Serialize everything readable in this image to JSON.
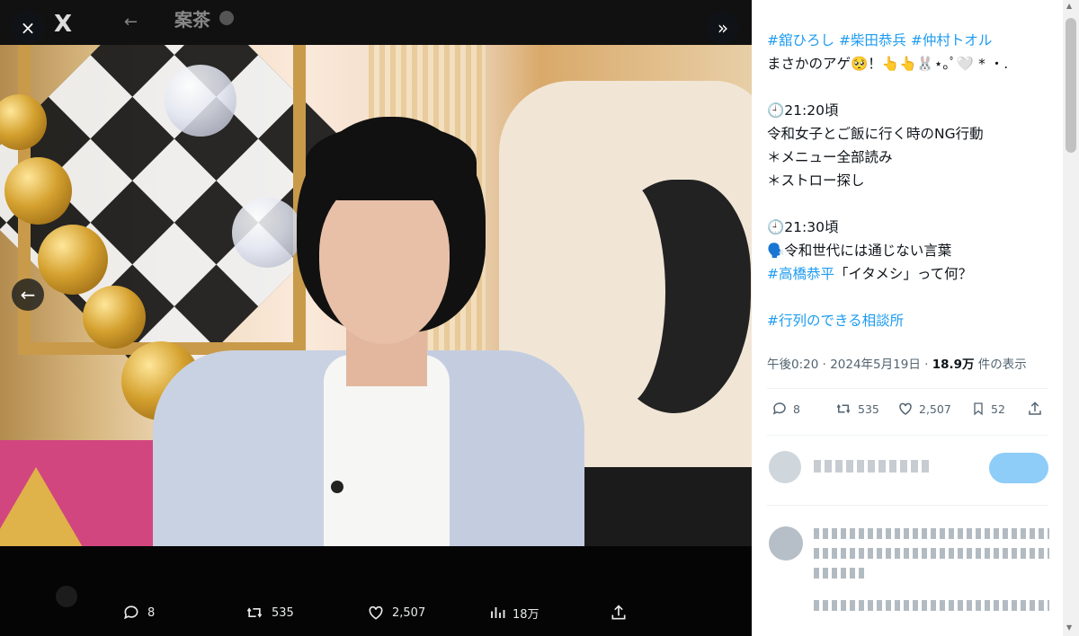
{
  "viewer": {
    "close_icon": "×",
    "expand_icon": "»",
    "prev_icon": "←",
    "background_header": {
      "logo": "X",
      "back_icon": "←",
      "account_name": "案茶"
    }
  },
  "image_actions": {
    "reply_count": "8",
    "retweet_count": "535",
    "like_count": "2,507",
    "views_count": "18万"
  },
  "tweet": {
    "lines": [
      [
        {
          "t": "#舘ひろし",
          "tag": true
        },
        {
          "t": " "
        },
        {
          "t": "#柴田恭兵",
          "tag": true
        },
        {
          "t": " "
        },
        {
          "t": "#仲村トオル",
          "tag": true
        }
      ],
      [
        {
          "t": "まさかのアゲ🥺！👆👆🐰⋆｡ﾟ🤍 * ・."
        }
      ],
      [],
      [
        {
          "t": "🕘21:20頃"
        }
      ],
      [
        {
          "t": "令和女子とご飯に行く時のNG行動"
        }
      ],
      [
        {
          "t": "＊メニュー全部読み"
        }
      ],
      [
        {
          "t": "＊ストロー探し"
        }
      ],
      [],
      [
        {
          "t": "🕘21:30頃"
        }
      ],
      [
        {
          "t": "🗣️令和世代には通じない言葉"
        }
      ],
      [
        {
          "t": "#高橋恭平",
          "tag": true
        },
        {
          "t": "「イタメシ」って何？"
        }
      ],
      [],
      [
        {
          "t": "#行列のできる相談所",
          "tag": true
        }
      ]
    ],
    "meta": {
      "time": "午後0:20",
      "sep": " · ",
      "date": "2024年5月19日",
      "views_number": "18.9万",
      "views_suffix": " 件の表示"
    },
    "stats": {
      "reply": "8",
      "retweet": "535",
      "like": "2,507",
      "bookmark": "52"
    }
  },
  "icons": {
    "close": "close-icon",
    "expand": "chevron-double-right-icon",
    "prev": "arrow-left-icon",
    "reply": "speech-bubble-icon",
    "retweet": "retweet-icon",
    "like": "heart-icon",
    "views": "bar-chart-icon",
    "bookmark": "bookmark-icon",
    "share": "share-icon"
  },
  "colors": {
    "accent": "#1d9bf0",
    "text": "#0f1419",
    "muted": "#536471"
  }
}
